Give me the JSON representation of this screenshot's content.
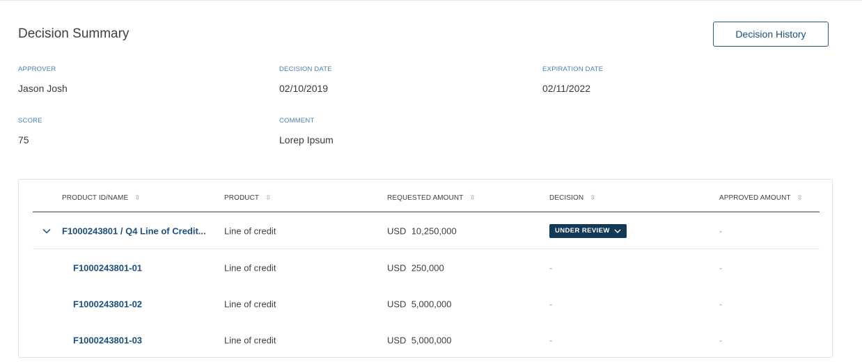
{
  "header": {
    "title": "Decision Summary",
    "history_button": "Decision History"
  },
  "fields": {
    "approver": {
      "label": "APPROVER",
      "value": "Jason Josh"
    },
    "decision_date": {
      "label": "DECISION DATE",
      "value": "02/10/2019"
    },
    "expiration_date": {
      "label": "EXPIRATION DATE",
      "value": "02/11/2022"
    },
    "score": {
      "label": "SCORE",
      "value": "75"
    },
    "comment": {
      "label": "COMMENT",
      "value": "Lorep Ipsum"
    }
  },
  "table": {
    "columns": [
      "PRODUCT ID/NAME",
      "PRODUCT",
      "REQUESTED AMOUNT",
      "DECISION",
      "APPROVED AMOUNT"
    ],
    "rows": [
      {
        "id": "F1000243801 / Q4 Line of Credit...",
        "product": "Line of credit",
        "currency": "USD",
        "amount": "10,250,000",
        "decision": "UNDER REVIEW",
        "approved": "-"
      },
      {
        "id": "F1000243801-01",
        "product": "Line of credit",
        "currency": "USD",
        "amount": "250,000",
        "decision": "-",
        "approved": "-"
      },
      {
        "id": "F1000243801-02",
        "product": "Line of credit",
        "currency": "USD",
        "amount": "5,000,000",
        "decision": "-",
        "approved": "-"
      },
      {
        "id": "F1000243801-03",
        "product": "Line of credit",
        "currency": "USD",
        "amount": "5,000,000",
        "decision": "-",
        "approved": "-"
      }
    ]
  },
  "icons": {
    "sort": "sort-icon",
    "expand": "chevron-down-icon",
    "dropdown": "chevron-down-icon"
  },
  "colors": {
    "badge_bg": "#123a56",
    "link": "#1d4f7c",
    "label": "#4a7fb0"
  }
}
